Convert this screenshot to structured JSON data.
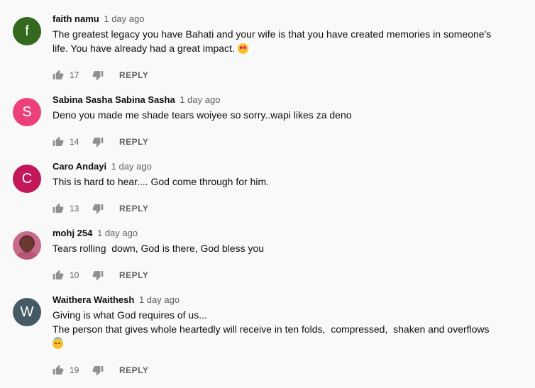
{
  "colors": {
    "background": "#f9f9f9",
    "meta_text": "#606060",
    "icon": "#909090"
  },
  "reply_label": "REPLY",
  "comments": [
    {
      "avatar": {
        "letter": "f",
        "color": "#33691e"
      },
      "author": "faith namu",
      "time": "1 day ago",
      "lines": [
        "The greatest legacy you have Bahati and your wife is that you have created memories in someone's",
        "life. You have already had a great impact."
      ],
      "emoji": "star-struck-emoji-icon",
      "likes": "17"
    },
    {
      "avatar": {
        "letter": "S",
        "color": "#ec407a"
      },
      "author": "Sabina Sasha Sabina Sasha",
      "time": "1 day ago",
      "lines": [
        "Deno you made me shade tears woiyee so sorry..wapi likes za deno"
      ],
      "likes": "14"
    },
    {
      "avatar": {
        "letter": "C",
        "color": "#c2185b"
      },
      "author": "Caro Andayi",
      "time": "1 day ago",
      "lines": [
        "This is hard to hear.... God come through for him."
      ],
      "likes": "13"
    },
    {
      "avatar": {
        "letter": "",
        "color": "#b85678",
        "photo": true
      },
      "author": "mohj 254",
      "time": "1 day ago",
      "lines": [
        "Tears rolling  down, God is there, God bless you"
      ],
      "likes": "10"
    },
    {
      "avatar": {
        "letter": "W",
        "color": "#455a64"
      },
      "author": "Waithera Waithesh",
      "time": "1 day ago",
      "lines": [
        "Giving is what God requires of us...",
        "The person that gives whole heartedly will receive in ten folds,  compressed,  shaken and overflows"
      ],
      "emoji": "smiling-halo-emoji-icon",
      "likes": "19"
    }
  ]
}
